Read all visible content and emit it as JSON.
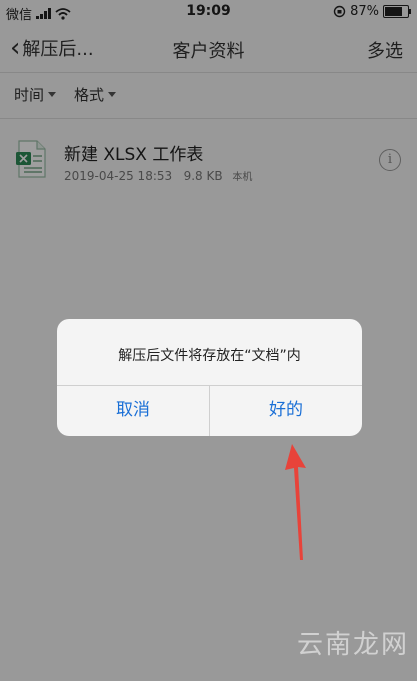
{
  "status_bar": {
    "carrier": "微信",
    "time": "19:09",
    "battery": "87%",
    "battery_level": 0.87
  },
  "nav": {
    "back_label": "解压后...",
    "title": "客户资料",
    "multi_select": "多选"
  },
  "filters": {
    "time_label": "时间",
    "format_label": "格式"
  },
  "file": {
    "name": "新建 XLSX 工作表",
    "date": "2019-04-25 18:53",
    "size": "9.8 KB",
    "location": "本机",
    "info_glyph": "i"
  },
  "alert": {
    "message": "解压后文件将存放在“文档”内",
    "cancel_label": "取消",
    "ok_label": "好的"
  },
  "colors": {
    "accent": "#1a6fd6",
    "arrow": "#e8433a",
    "xlsx_icon": "#2e8b57"
  },
  "watermark": {
    "brand": "云南龙网"
  }
}
